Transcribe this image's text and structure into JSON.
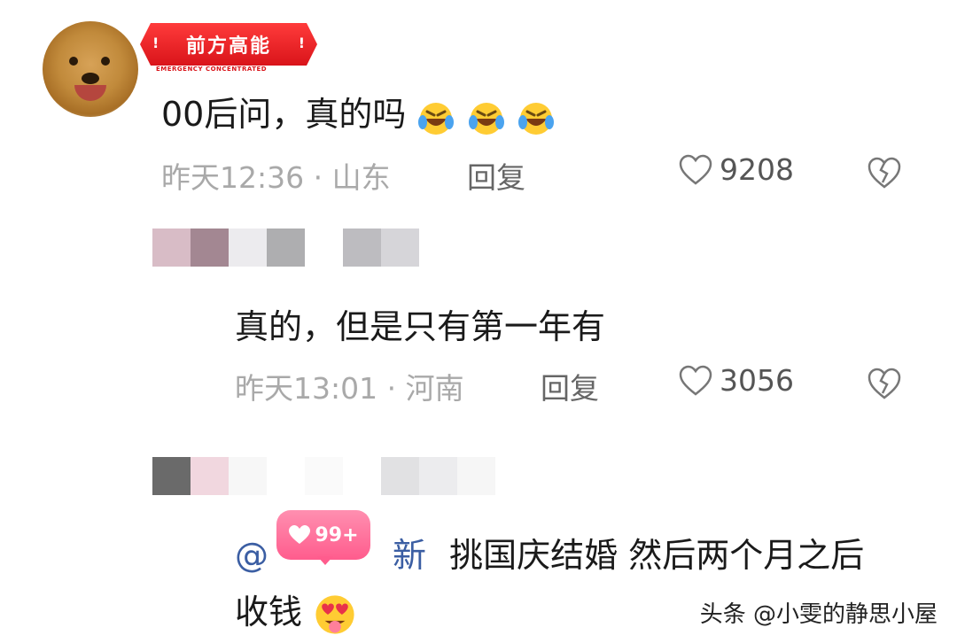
{
  "comment1": {
    "badge_label": "前方高能",
    "badge_sub": "EMERGENCY CONCENTRATED",
    "text": "00后问，真的吗",
    "time": "昨天12:36",
    "location": "山东",
    "reply_label": "回复",
    "likes": "9208"
  },
  "reply1": {
    "text": "真的，但是只有第一年有",
    "time": "昨天13:01",
    "location": "河南",
    "reply_label": "回复",
    "likes": "3056"
  },
  "reply2": {
    "mention_prefix": "@",
    "mention_suffix": "新",
    "text_line1": "挑国庆结婚 然后两个月之后",
    "text_line2": "收钱",
    "bubble_count": "99+"
  },
  "separator": "·",
  "watermark": "头条 @小雯的静思小屋"
}
